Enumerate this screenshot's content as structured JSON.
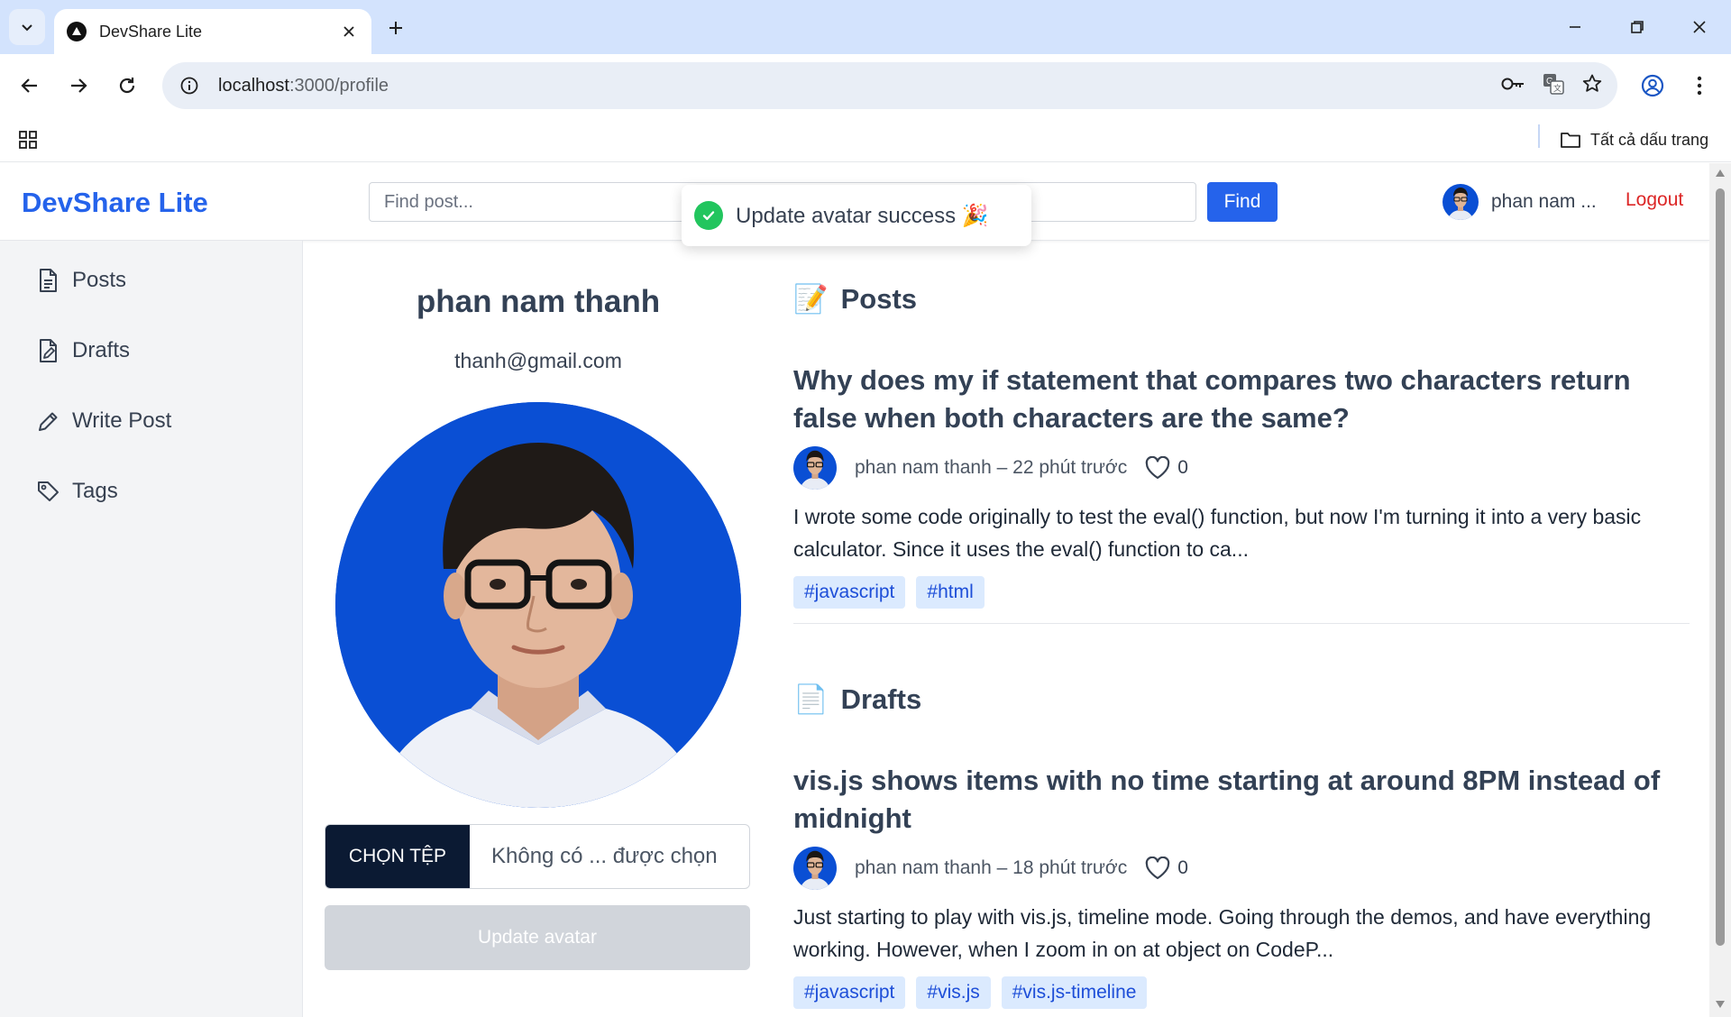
{
  "browser": {
    "tab_title": "DevShare Lite",
    "url_host": "localhost",
    "url_path": ":3000/profile",
    "bookmarks_all": "Tất cả dấu trang"
  },
  "header": {
    "brand": "DevShare Lite",
    "search_placeholder": "Find post...",
    "find_label": "Find",
    "user_name": "phan nam ...",
    "logout_label": "Logout"
  },
  "toast": {
    "message": "Update avatar success 🎉"
  },
  "sidebar": {
    "items": [
      {
        "label": "Posts",
        "icon": "document-icon"
      },
      {
        "label": "Drafts",
        "icon": "draft-icon"
      },
      {
        "label": "Write Post",
        "icon": "pencil-icon"
      },
      {
        "label": "Tags",
        "icon": "tag-icon"
      }
    ]
  },
  "profile": {
    "name": "phan nam thanh",
    "email": "thanh@gmail.com",
    "choose_file_label": "CHỌN TỆP",
    "file_status": "Không có ... được chọn",
    "update_avatar_label": "Update avatar"
  },
  "posts_section": {
    "icon": "📝",
    "title": "Posts",
    "items": [
      {
        "title": "Why does my if statement that compares two characters return false when both characters are the same?",
        "author_time": "phan nam thanh – 22 phút trước",
        "likes": "0",
        "excerpt": "I wrote some code originally to test the eval() function, but now I'm turning it into a very basic calculator. Since it uses the eval() function to ca...",
        "tags": [
          "#javascript",
          "#html"
        ]
      }
    ]
  },
  "drafts_section": {
    "icon": "📄",
    "title": "Drafts",
    "items": [
      {
        "title": "vis.js shows items with no time starting at around 8PM instead of midnight",
        "author_time": "phan nam thanh – 18 phút trước",
        "likes": "0",
        "excerpt": "Just starting to play with vis.js, timeline mode. Going through the demos, and have everything working. However, when I zoom in on at object on CodeP...",
        "tags": [
          "#javascript",
          "#vis.js",
          "#vis.js-timeline"
        ]
      }
    ]
  },
  "colors": {
    "brand": "#2563eb",
    "logout": "#dc2626",
    "tag_bg": "#dbeafe",
    "toast_success": "#22c55e"
  }
}
